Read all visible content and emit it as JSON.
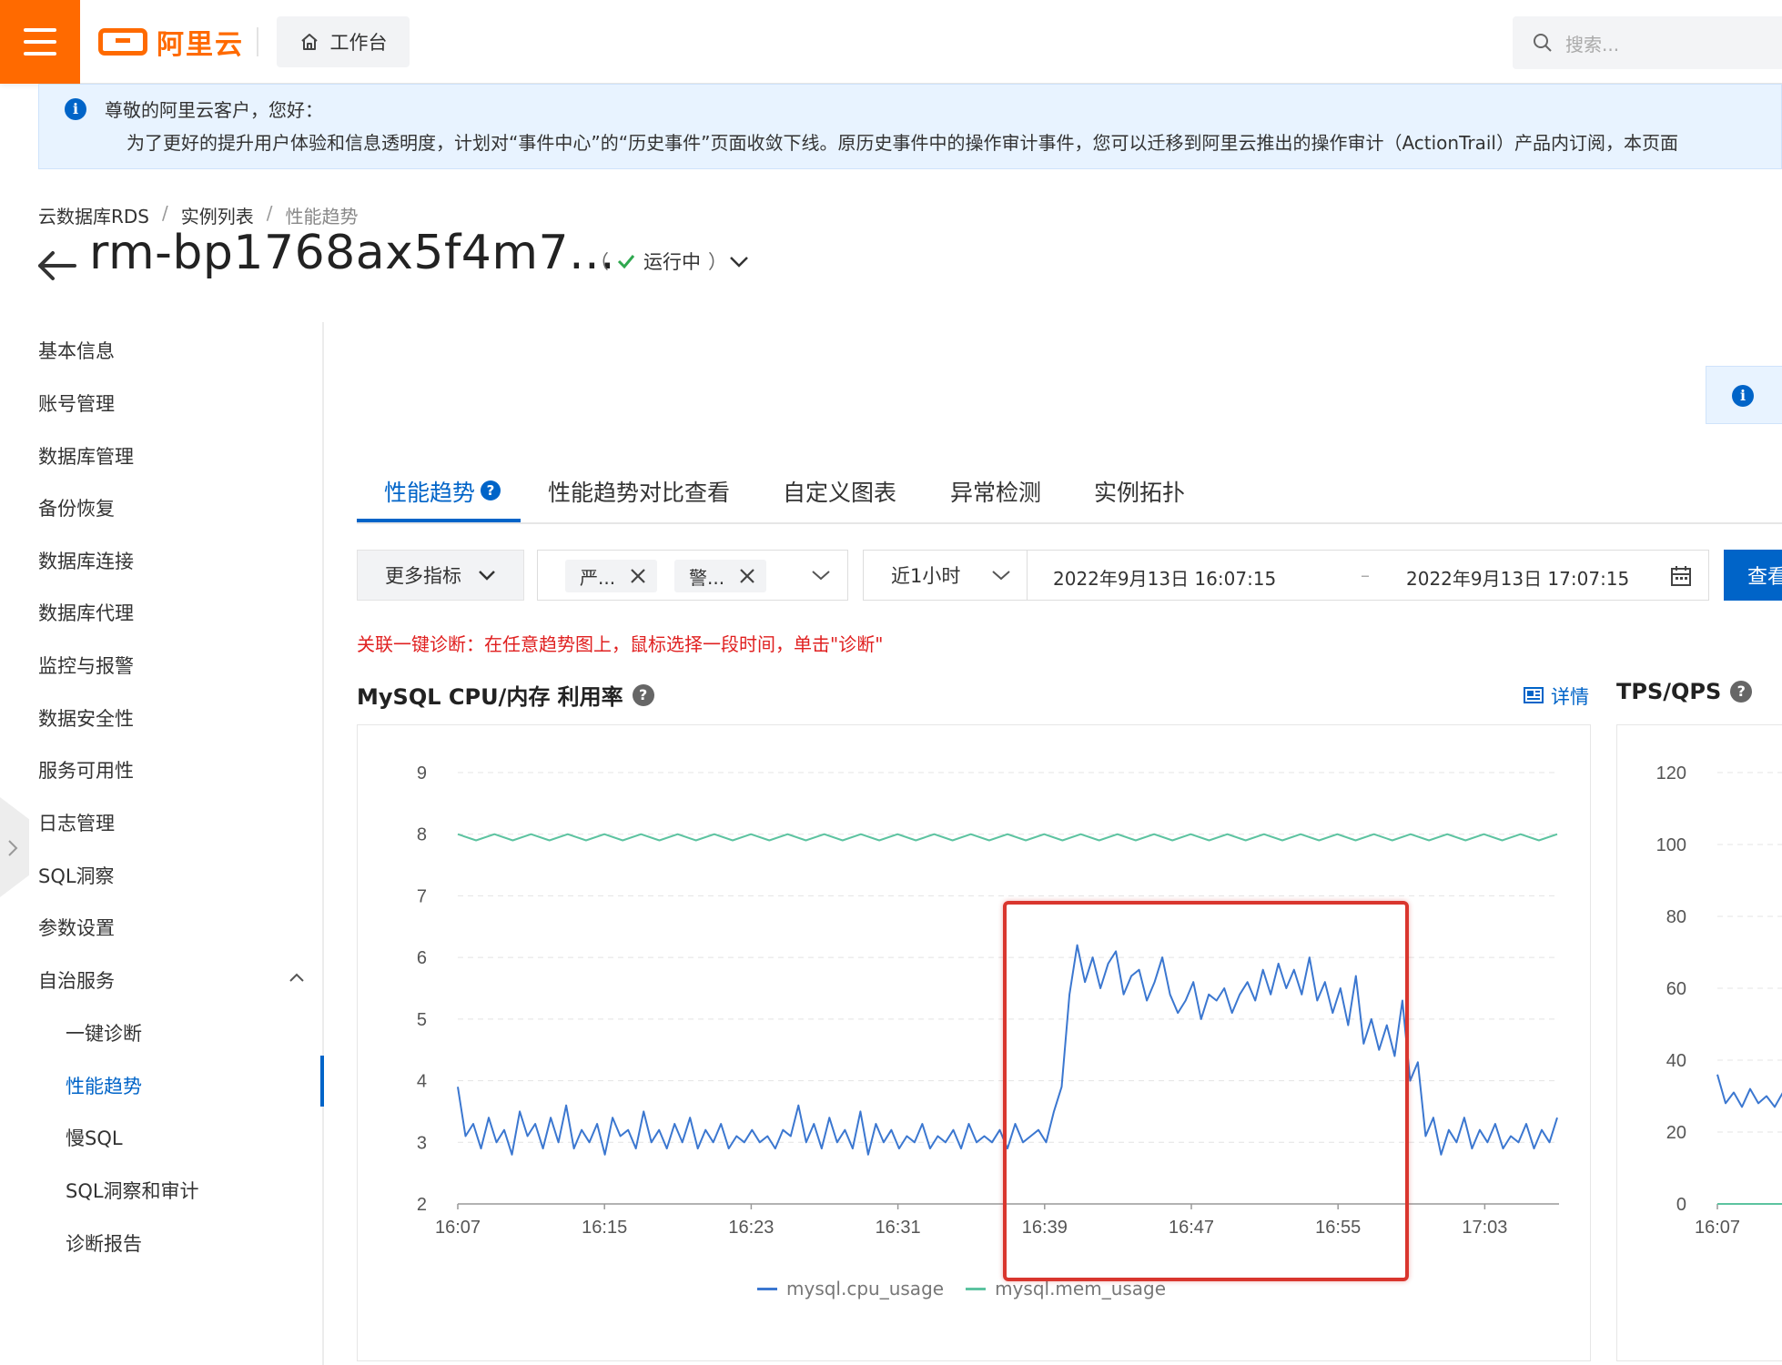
{
  "topbar": {
    "menu_icon": "hamburger-icon",
    "brand": "阿里云",
    "workbench_label": "工作台",
    "search_placeholder": "搜索..."
  },
  "notice": {
    "title": "尊敬的阿里云客户，您好：",
    "body": "为了更好的提升用户体验和信息透明度，计划对“事件中心”的“历史事件”页面收敛下线。原历史事件中的操作审计事件，您可以迁移到阿里云推出的操作审计（ActionTrail）产品内订阅，本页面"
  },
  "breadcrumb": [
    "云数据库RDS",
    "实例列表",
    "性能趋势"
  ],
  "breadcrumb_sep": "/",
  "instance": {
    "title": "rm-bp1768ax5f4m7...",
    "status_open": "（",
    "status": "运行中",
    "status_close": "）"
  },
  "sidebar": {
    "items": [
      "基本信息",
      "账号管理",
      "数据库管理",
      "备份恢复",
      "数据库连接",
      "数据库代理",
      "监控与报警",
      "数据安全性",
      "服务可用性",
      "日志管理",
      "SQL洞察",
      "参数设置",
      "自治服务"
    ],
    "sub_items": [
      "一键诊断",
      "性能趋势",
      "慢SQL",
      "SQL洞察和审计",
      "诊断报告"
    ],
    "active": "性能趋势"
  },
  "tabs": [
    "性能趋势",
    "性能趋势对比查看",
    "自定义图表",
    "异常检测",
    "实例拓扑"
  ],
  "filters": {
    "metrics_button": "更多指标",
    "tags": [
      "严...",
      "警..."
    ],
    "range": "近1小时",
    "start": "2022年9月13日 16:07:15",
    "dash": "–",
    "end": "2022年9月13日 17:07:15",
    "query_button": "查看"
  },
  "hint": "关联一键诊断：在任意趋势图上，鼠标选择一段时间，单击\"诊断\"",
  "detail_link": "详情",
  "colors": {
    "accent": "#0064c8",
    "brand": "#ff6a00",
    "cpu": "#3b77d0",
    "mem": "#5cc3a0",
    "alert": "#e02020"
  },
  "chart_data": [
    {
      "type": "line",
      "title": "MySQL CPU/内存 利用率",
      "x": [
        "16:07",
        "16:15",
        "16:23",
        "16:31",
        "16:39",
        "16:47",
        "16:55",
        "17:03"
      ],
      "ylim": [
        2,
        9
      ],
      "yticks": [
        2,
        3,
        4,
        5,
        6,
        7,
        8,
        9
      ],
      "series": [
        {
          "name": "mysql.cpu_usage",
          "color": "#3b77d0",
          "values": [
            3.9,
            3.1,
            3.3,
            2.9,
            3.4,
            3.0,
            3.2,
            2.8,
            3.5,
            3.1,
            3.3,
            2.9,
            3.4,
            3.0,
            3.6,
            2.9,
            3.2,
            3.0,
            3.3,
            2.8,
            3.4,
            3.1,
            3.2,
            2.9,
            3.5,
            3.0,
            3.2,
            2.9,
            3.3,
            3.0,
            3.4,
            2.9,
            3.2,
            3.0,
            3.3,
            2.9,
            3.1,
            3.0,
            3.2,
            3.0,
            3.1,
            2.9,
            3.2,
            3.1,
            3.6,
            3.0,
            3.3,
            2.9,
            3.4,
            3.0,
            3.2,
            2.9,
            3.5,
            2.8,
            3.3,
            3.0,
            3.2,
            2.9,
            3.1,
            3.0,
            3.3,
            2.9,
            3.1,
            3.0,
            3.2,
            2.9,
            3.3,
            3.0,
            3.1,
            3.0,
            3.2,
            2.9,
            3.3,
            3.0,
            3.1,
            3.2,
            3.0,
            3.5,
            3.9,
            5.4,
            6.2,
            5.6,
            6.0,
            5.5,
            5.9,
            6.1,
            5.4,
            5.7,
            5.8,
            5.3,
            5.6,
            6.0,
            5.4,
            5.1,
            5.3,
            5.6,
            5.0,
            5.4,
            5.3,
            5.5,
            5.1,
            5.4,
            5.6,
            5.3,
            5.8,
            5.4,
            5.9,
            5.5,
            5.8,
            5.4,
            6.0,
            5.3,
            5.6,
            5.1,
            5.5,
            4.9,
            5.7,
            4.6,
            5.0,
            4.5,
            4.9,
            4.4,
            5.3,
            4.0,
            4.3,
            3.1,
            3.4,
            2.8,
            3.2,
            3.0,
            3.4,
            2.9,
            3.2,
            3.0,
            3.3,
            2.9,
            3.1,
            3.0,
            3.3,
            2.9,
            3.2,
            3.0,
            3.4
          ]
        },
        {
          "name": "mysql.mem_usage",
          "color": "#5cc3a0",
          "values": [
            8.0,
            7.9,
            8.0,
            7.9,
            8.0,
            7.9,
            8.0,
            7.9,
            8.0,
            7.9,
            8.0,
            7.9,
            8.0,
            7.9,
            8.0,
            7.9,
            8.0,
            7.9,
            8.0,
            7.9,
            8.0,
            7.9,
            8.0,
            7.9,
            8.0,
            7.9,
            8.0,
            7.9,
            8.0,
            7.9,
            8.0,
            7.9,
            8.0,
            7.9,
            8.0,
            7.9,
            8.0,
            7.9,
            8.0,
            7.9,
            8.0,
            7.9,
            8.0,
            7.9,
            8.0,
            7.9,
            8.0,
            7.9,
            8.0,
            7.9,
            8.0,
            7.9,
            8.0,
            7.9,
            8.0,
            7.9,
            8.0,
            7.9,
            8.0,
            7.9,
            8.0
          ]
        }
      ]
    },
    {
      "type": "line",
      "title": "TPS/QPS",
      "x": [
        "16:07"
      ],
      "ylim": [
        0,
        120
      ],
      "yticks": [
        0,
        20,
        40,
        60,
        80,
        100,
        120
      ],
      "series": [
        {
          "color": "#3b77d0",
          "values": [
            36,
            28,
            31,
            27,
            32,
            28,
            30,
            27,
            31,
            26,
            30
          ]
        },
        {
          "color": "#5cc3a0",
          "values": [
            0,
            0,
            0,
            0,
            0,
            0,
            0,
            0,
            0,
            0,
            0
          ]
        }
      ]
    }
  ]
}
